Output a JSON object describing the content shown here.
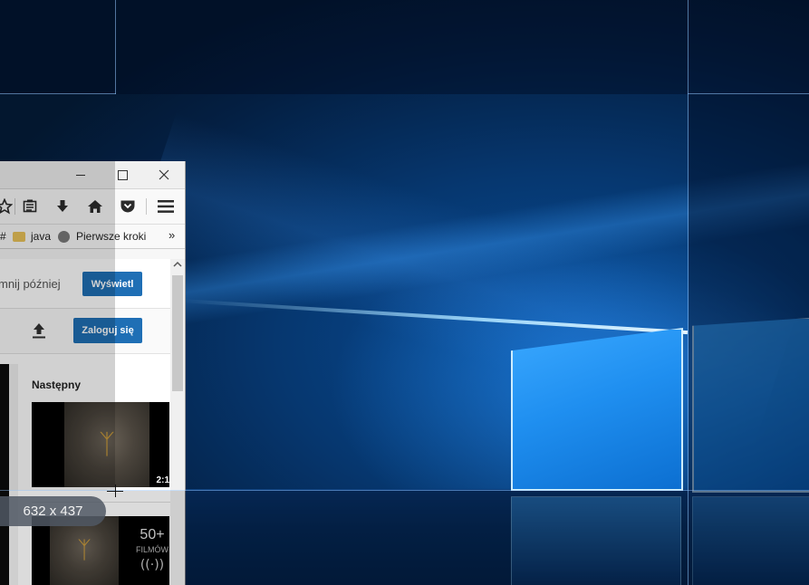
{
  "browser": {
    "window_controls": {
      "minimize": "—",
      "maximize": "☐",
      "close": "✕"
    },
    "toolbar_icons": [
      "star-icon",
      "reading-list-icon",
      "download-icon",
      "home-icon",
      "pocket-icon",
      "menu-icon"
    ],
    "bookmarks": {
      "hash": "#",
      "items": [
        {
          "label": "java",
          "icon": "folder-icon"
        },
        {
          "label": "Pierwsze kroki",
          "icon": "globe-icon"
        }
      ],
      "overflow": "»"
    },
    "notice": {
      "text": "mnij później",
      "button": "Wyświetl"
    },
    "login": {
      "button": "Zaloguj się"
    },
    "sidebar": {
      "next_label": "Następny",
      "thumb1_duration": "2:1",
      "playlist_count": "50+",
      "playlist_label": "FILMÓW"
    }
  },
  "overlay": {
    "size_readout": "632 x 437"
  },
  "colors": {
    "accent_button": "#1f6fb5",
    "wallpaper_blue": "#0a4f9c"
  }
}
